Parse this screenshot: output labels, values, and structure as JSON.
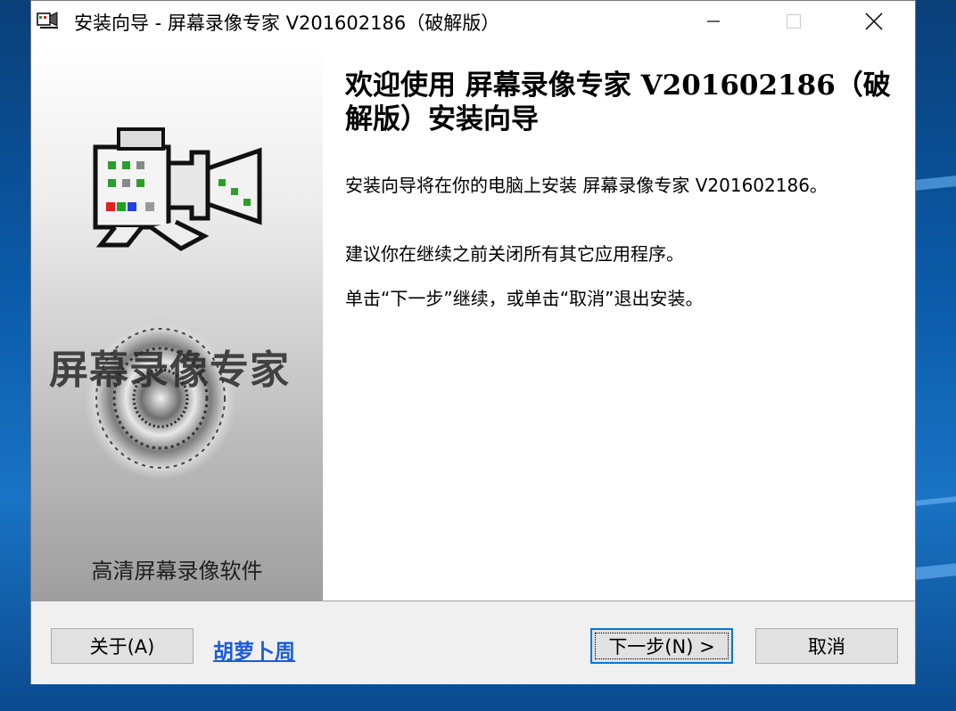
{
  "window": {
    "title": "安装向导 - 屏幕录像专家 V201602186（破解版）"
  },
  "banner": {
    "logo_text": "屏幕录像专家",
    "caption": "高清屏幕录像软件"
  },
  "main": {
    "heading": "欢迎使用 屏幕录像专家 V201602186（破解版）安装向导",
    "paragraph1": "安装向导将在你的电脑上安装 屏幕录像专家 V201602186。",
    "paragraph2": "建议你在继续之前关闭所有其它应用程序。",
    "paragraph3": "单击“下一步”继续，或单击“取消”退出安装。"
  },
  "footer": {
    "about_label": "关于(A)",
    "link_label": "胡萝卜周",
    "next_label": "下一步(N) >",
    "cancel_label": "取消"
  },
  "icons": {
    "app": "installer-app-icon",
    "minimize": "minimize-icon",
    "maximize": "maximize-icon",
    "close": "close-icon",
    "camera": "video-camera-icon"
  },
  "colors": {
    "link": "#1a5cd8",
    "focus": "#0078d7",
    "desktop": "#0b5aa8"
  }
}
